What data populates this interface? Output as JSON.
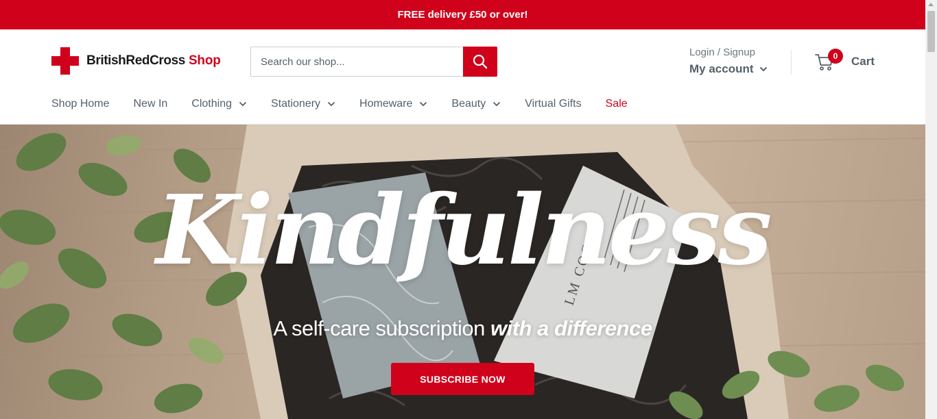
{
  "announcement": {
    "text": "FREE delivery £50 or over!"
  },
  "header": {
    "logo": {
      "brand": "BritishRedCross",
      "shop": "Shop"
    },
    "search": {
      "placeholder": "Search our shop...",
      "icon": "search-icon"
    },
    "account": {
      "login_signup": "Login / Signup",
      "my_account": "My account"
    },
    "cart": {
      "count": "0",
      "label": "Cart",
      "icon": "cart-icon"
    }
  },
  "nav": {
    "items": [
      {
        "label": "Shop Home",
        "dropdown": false
      },
      {
        "label": "New In",
        "dropdown": false
      },
      {
        "label": "Clothing",
        "dropdown": true
      },
      {
        "label": "Stationery",
        "dropdown": true
      },
      {
        "label": "Homeware",
        "dropdown": true
      },
      {
        "label": "Beauty",
        "dropdown": true
      },
      {
        "label": "Virtual Gifts",
        "dropdown": false
      },
      {
        "label": "Sale",
        "dropdown": false
      }
    ]
  },
  "hero": {
    "title": "Kindfulness",
    "subtitle_plain": "A self-care subscription ",
    "subtitle_emphasis": "with a difference",
    "button": "SUBSCRIBE NOW",
    "package_text": "LM COCOA"
  },
  "colors": {
    "brand_red": "#d0021b",
    "text_grey": "#54606b"
  }
}
